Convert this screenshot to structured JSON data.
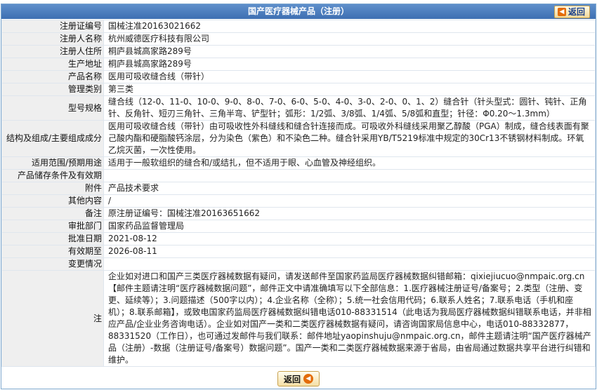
{
  "title": "国产医疗器械产品（注册）",
  "back_label": "返回",
  "rows": [
    {
      "label": "注册证编号",
      "value": "国械注准20163021662"
    },
    {
      "label": "注册人名称",
      "value": "杭州威德医疗科技有限公司"
    },
    {
      "label": "注册人住所",
      "value": "桐庐县城高家路289号"
    },
    {
      "label": "生产地址",
      "value": "桐庐县城高家路289号"
    },
    {
      "label": "产品名称",
      "value": "医用可吸收缝合线（带针）"
    },
    {
      "label": "管理类别",
      "value": "第三类"
    },
    {
      "label": "型号规格",
      "value": "缝合线（12-0、11-0、10-0、9-0、8-0、7-0、6-0、5-0、4-0、3-0、2-0、0、1、2）缝合针（针头型式：圆针、钝针、正角针、反角针、短刃三角针、三角半弯、铲型针；弧形：1/2弧、3/8弧、1/4弧、5/8弧和直型；针径：Φ0.20～1.3mm）"
    },
    {
      "label": "结构及组成/主要组成成分",
      "value": "医用可吸收缝合线（带针）由可吸收性外科缝线和缝合针连接而成。可吸收外科缝线采用聚乙醇酸（PGA）制成，缝合线表面有聚己酸内酯和硬脂酸钙涂层，分为染色（紫色）和不染色二种。缝合针采用YB/T5219标准中规定的30Cr13不锈钢材料制成。环氧乙烷灭菌，一次性使用。"
    },
    {
      "label": "适用范围/预期用途",
      "value": "适用于一般软组织的缝合和/或结扎，但不适用于眼、心血管及神经组织。"
    },
    {
      "label": "产品储存条件及有效期",
      "value": ""
    },
    {
      "label": "附件",
      "value": "产品技术要求"
    },
    {
      "label": "其他内容",
      "value": "/"
    },
    {
      "label": "备注",
      "value": "原注册证编号：国械注准20163651662"
    },
    {
      "label": "审批部门",
      "value": "国家药品监督管理局"
    },
    {
      "label": "批准日期",
      "value": "2021-08-12"
    },
    {
      "label": "有效期至",
      "value": "2026-08-11"
    },
    {
      "label": "变更情况",
      "value": ""
    },
    {
      "label": "注",
      "value": "企业如对进口和国产三类医疗器械数据有疑问，请发送邮件至国家药监局医疗器械数据纠错邮箱：qixiejiucuo@nmpaic.org.cn【邮件主题请注明“医疗器械数据问题”，邮件正文中请准确填写以下全部信息：1.医疗器械注册证号/备案号；2.类型（注册、变更、延续等）；3.问题描述（500字以内）；4.企业名称（全称）；5.统一社会信用代码；6.联系人姓名；7.联系电话（手机和座机）；8.联系邮箱】，或致电国家药监局医疗器械数据纠错电话010-88331514（此电话为我局医疗器械数据纠错联系电话，并非相应产品/企业业务咨询电话）。企业如对国产一类和二类医疗器械数据有疑问，请咨询国家局信息中心，电话010-88332877，88331520（工作日），也可通过发邮件与我们联系：邮件地址yaopinshuju@nmpaic.org.cn，邮件主题请注明“国产医疗器械产品（注册）-数据（注册证号/备案号）数据问题”。国产一类和二类医疗器械数据来源于省局，由省局通过数据共享平台进行纠错和维护。"
    }
  ]
}
